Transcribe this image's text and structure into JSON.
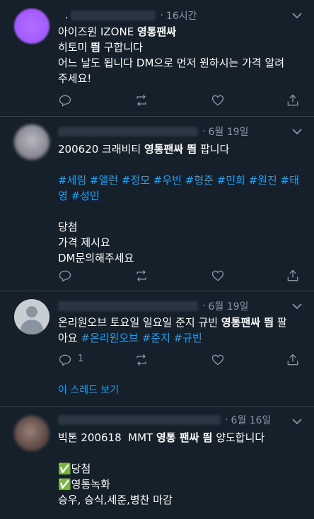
{
  "tweets": [
    {
      "handle": ".",
      "time": "16시간",
      "lines": [
        [
          {
            "t": "아이즈원 IZONE "
          },
          {
            "t": "영통팬싸",
            "b": true
          }
        ],
        [
          {
            "t": "히토미 "
          },
          {
            "t": "띔",
            "b": true
          },
          {
            "t": " 구합니다"
          }
        ],
        [
          {
            "t": "어느 날도 됩니다 DM으로 먼저 원하시는 가격 알려"
          }
        ],
        [
          {
            "t": "주세요!"
          }
        ]
      ],
      "reply_count": "",
      "retweet_count": "",
      "like_count": ""
    },
    {
      "handle": "",
      "time": "6월 19일",
      "lines": [
        [
          {
            "t": "200620 크래비티 "
          },
          {
            "t": "영통팬싸 띔",
            "b": true
          },
          {
            "t": " 팝니다"
          }
        ],
        [
          {
            "t": ""
          }
        ],
        [
          {
            "t": "#세림 #앨런 #정모 #우빈 #형준 #민희 #원진 #태",
            "tag": true
          }
        ],
        [
          {
            "t": "영 #성민",
            "tag": true
          }
        ],
        [
          {
            "t": ""
          }
        ],
        [
          {
            "t": "당첨"
          }
        ],
        [
          {
            "t": "가격 제시요"
          }
        ],
        [
          {
            "t": "DM문의해주세요"
          }
        ]
      ],
      "reply_count": "",
      "retweet_count": "",
      "like_count": ""
    },
    {
      "handle": "",
      "time": "6월 19일",
      "lines": [
        [
          {
            "t": "온리원오브 토요일 일요일 준지 규빈 "
          },
          {
            "t": "영통팬싸 띔",
            "b": true
          },
          {
            "t": " 팔"
          }
        ],
        [
          {
            "t": "아요 "
          },
          {
            "t": "#온리원오브 #준지 #규빈",
            "tag": true
          }
        ]
      ],
      "reply_count": "1",
      "retweet_count": "",
      "like_count": "",
      "thread_link": "이 스레드 보기"
    },
    {
      "handle": "",
      "time": "6월 16일",
      "lines": [
        [
          {
            "t": "빅톤 200618  MMT "
          },
          {
            "t": "영통 팬싸 띔",
            "b": true
          },
          {
            "t": " 양도합니다"
          }
        ],
        [
          {
            "t": ""
          }
        ],
        [
          {
            "t": "✅당첨"
          }
        ],
        [
          {
            "t": "✅영통녹화"
          }
        ],
        [
          {
            "t": "승우, 승식,세준,병찬 마감"
          }
        ]
      ]
    }
  ],
  "icons": {
    "reply": "reply-icon",
    "retweet": "retweet-icon",
    "like": "like-icon",
    "share": "share-icon",
    "caret": "chevron-down-icon"
  },
  "colors": {
    "background": "#15202b",
    "divider": "#38444d",
    "muted": "#8899a6",
    "link": "#1da1f2"
  }
}
